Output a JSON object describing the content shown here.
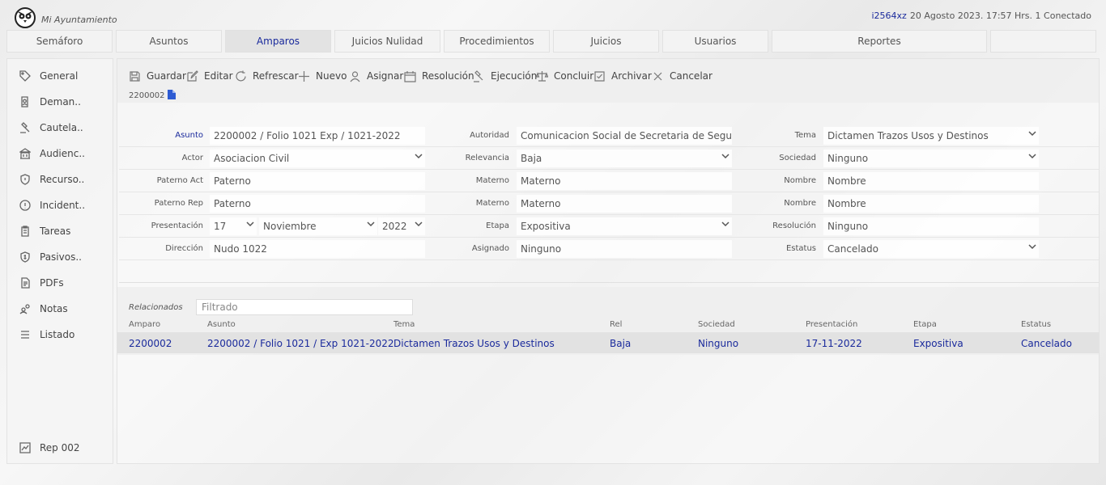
{
  "app": {
    "name": "Mi Ayuntamiento"
  },
  "user": {
    "id": "i2564xz",
    "status": "20 Agosto 2023. 17:57 Hrs. 1 Conectado"
  },
  "tabs": [
    {
      "label": "Semáforo"
    },
    {
      "label": "Asuntos"
    },
    {
      "label": "Amparos"
    },
    {
      "label": "Juicios Nulidad"
    },
    {
      "label": "Procedimientos"
    },
    {
      "label": "Juicios"
    },
    {
      "label": "Usuarios"
    },
    {
      "label": "Reportes"
    },
    {
      "label": ""
    }
  ],
  "active_tab": "Amparos",
  "sidebar": {
    "items": [
      {
        "label": "General",
        "icon": "tag-icon"
      },
      {
        "label": "Deman..",
        "icon": "document-person-icon"
      },
      {
        "label": "Cautela..",
        "icon": "gavel-icon"
      },
      {
        "label": "Audienc..",
        "icon": "building-icon"
      },
      {
        "label": "Recurso..",
        "icon": "shield-icon"
      },
      {
        "label": "Incident..",
        "icon": "alert-icon"
      },
      {
        "label": "Tareas",
        "icon": "clipboard-icon"
      },
      {
        "label": "Pasivos..",
        "icon": "money-shield-icon"
      },
      {
        "label": "PDFs",
        "icon": "pdf-icon"
      },
      {
        "label": "Notas",
        "icon": "people-icon"
      },
      {
        "label": "Listado",
        "icon": "list-icon"
      }
    ],
    "footer": {
      "label": "Rep 002",
      "icon": "chart-icon"
    }
  },
  "toolbar": {
    "buttons": [
      {
        "label": "Guardar",
        "icon": "save-icon"
      },
      {
        "label": "Editar",
        "icon": "edit-icon"
      },
      {
        "label": "Refrescar",
        "icon": "refresh-icon"
      },
      {
        "label": "Nuevo",
        "icon": "plus-icon"
      },
      {
        "label": "Asignar",
        "icon": "user-icon"
      },
      {
        "label": "Resolución",
        "icon": "calendar-icon"
      },
      {
        "label": "Ejecución",
        "icon": "gavel-icon"
      },
      {
        "label": "Concluir",
        "icon": "scale-icon"
      },
      {
        "label": "Archivar",
        "icon": "check-box-icon"
      },
      {
        "label": "Cancelar",
        "icon": "close-icon"
      }
    ],
    "record_id": "2200002"
  },
  "form": {
    "asunto": {
      "label": "Asunto",
      "value": "2200002 / Folio 1021 Exp / 1021-2022"
    },
    "autoridad": {
      "label": "Autoridad",
      "value": "Comunicacion Social de Secretaria de Segurida.."
    },
    "tema": {
      "label": "Tema",
      "value": "Dictamen Trazos Usos y Destinos"
    },
    "actor": {
      "label": "Actor",
      "value": "Asociacion Civil"
    },
    "relevancia": {
      "label": "Relevancia",
      "value": "Baja"
    },
    "sociedad": {
      "label": "Sociedad",
      "value": "Ninguno"
    },
    "paterno_act": {
      "label": "Paterno Act",
      "value": "Paterno"
    },
    "materno_act": {
      "label": "Materno",
      "value": "Materno"
    },
    "nombre_act": {
      "label": "Nombre",
      "value": "Nombre"
    },
    "paterno_rep": {
      "label": "Paterno Rep",
      "value": "Paterno"
    },
    "materno_rep": {
      "label": "Materno",
      "value": "Materno"
    },
    "nombre_rep": {
      "label": "Nombre",
      "value": "Nombre"
    },
    "presentacion": {
      "label": "Presentación",
      "day": "17",
      "month": "Noviembre",
      "year": "2022"
    },
    "etapa": {
      "label": "Etapa",
      "value": "Expositiva"
    },
    "resolucion": {
      "label": "Resolución",
      "value": "Ninguno"
    },
    "direccion": {
      "label": "Dirección",
      "value": "Nudo 1022"
    },
    "asignado": {
      "label": "Asignado",
      "value": "Ninguno"
    },
    "estatus": {
      "label": "Estatus",
      "value": "Cancelado"
    }
  },
  "related": {
    "label": "Relacionados",
    "filter_placeholder": "Filtrado",
    "columns": [
      "Amparo",
      "Asunto",
      "Tema",
      "Rel",
      "Sociedad",
      "Presentación",
      "Etapa",
      "Estatus"
    ],
    "rows": [
      [
        "2200002",
        "2200002 / Folio 1021 / Exp 1021-2022",
        "Dictamen Trazos Usos y Destinos",
        "Baja",
        "Ninguno",
        "17-11-2022",
        "Expositiva",
        "Cancelado"
      ]
    ]
  },
  "colors": {
    "accent": "#1a2a9c",
    "row_highlight": "#e2e2e2"
  }
}
